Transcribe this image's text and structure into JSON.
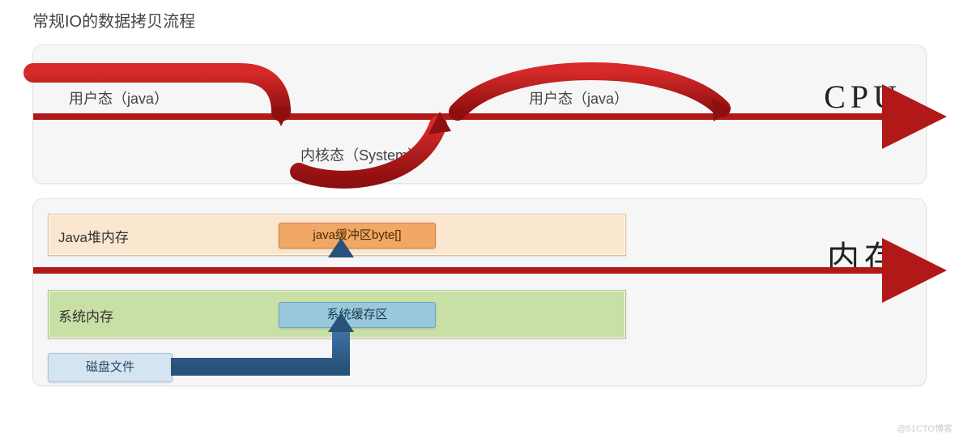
{
  "title": "常规IO的数据拷贝流程",
  "cpu": {
    "label": "CPU",
    "user1": "用户态（java）",
    "kernel": "内核态（System）",
    "user2": "用户态（java）"
  },
  "mem": {
    "label": "内存",
    "heap": {
      "title": "Java堆内存",
      "buffer": "java缓冲区byte[]"
    },
    "sys": {
      "title": "系统内存",
      "buffer": "系统缓存区"
    },
    "disk": "磁盘文件"
  },
  "watermark": "@51CTO博客"
}
